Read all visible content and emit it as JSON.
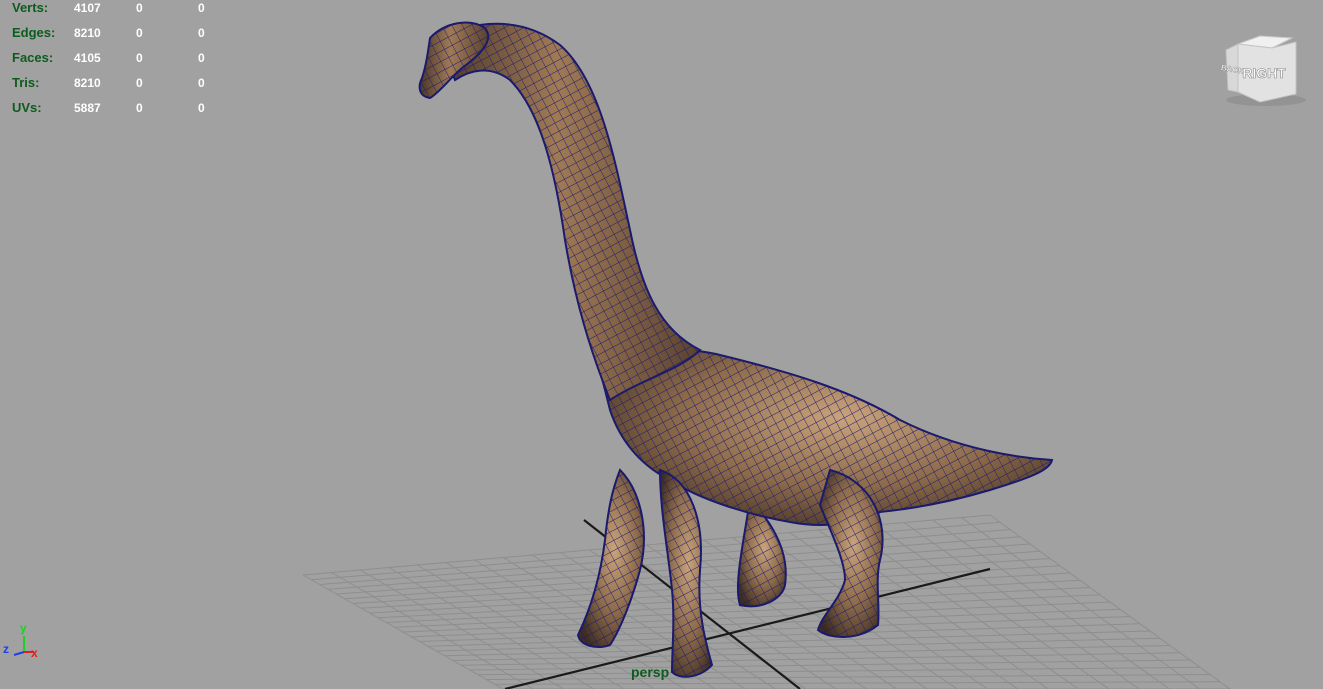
{
  "hud": {
    "rows": [
      {
        "label": "Verts:",
        "values": [
          "4107",
          "0",
          "0"
        ]
      },
      {
        "label": "Edges:",
        "values": [
          "8210",
          "0",
          "0"
        ]
      },
      {
        "label": "Faces:",
        "values": [
          "4105",
          "0",
          "0"
        ]
      },
      {
        "label": "Tris:",
        "values": [
          "8210",
          "0",
          "0"
        ]
      },
      {
        "label": "UVs:",
        "values": [
          "5887",
          "0",
          "0"
        ]
      }
    ]
  },
  "camera": {
    "name": "persp"
  },
  "view_cube": {
    "front_label": "RIGHT",
    "side_label": "BACK",
    "icon": "view-cube-icon"
  },
  "axis_gizmo": {
    "x": "x",
    "y": "y",
    "z": "z",
    "icon": "axis-gizmo-icon"
  },
  "colors": {
    "background": "#a1a1a1",
    "hud_label": "#0c5c1e",
    "hud_value": "#ffffff",
    "wireframe": "#1a1a6e",
    "skin": "#8a6a48",
    "grid": "#8c8c8c",
    "axis_x": "#e02020",
    "axis_y": "#20d020",
    "axis_z": "#2040e0"
  }
}
